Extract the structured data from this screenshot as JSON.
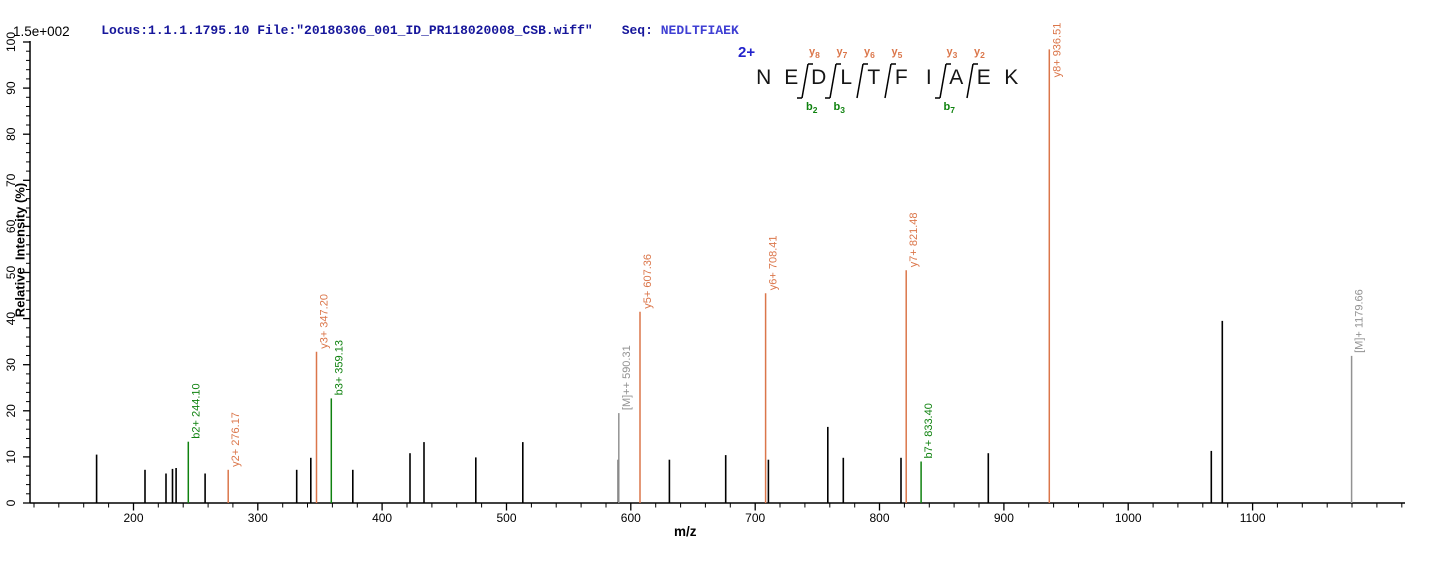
{
  "header": {
    "locus_file": "Locus:1.1.1.1795.10 File:\"20180306_001_ID_PR118020008_CSB.wiff\"",
    "seq_label": "Seq:",
    "seq_value": "NEDLTFIAEK",
    "scale_note": "1.5e+002"
  },
  "sequence": {
    "charge": "2+",
    "residues": "NEDLTFIAEK",
    "cleavages": [
      {
        "after": 2,
        "y": "y8",
        "b": "b2"
      },
      {
        "after": 3,
        "y": "y7",
        "b": "b3"
      },
      {
        "after": 4,
        "y": "y6"
      },
      {
        "after": 5,
        "y": "y5"
      },
      {
        "after": 7,
        "y": "y3",
        "b": "b7"
      },
      {
        "after": 8,
        "y": "y2"
      }
    ]
  },
  "colors": {
    "y_ion": "#DB764A",
    "b_ion": "#0F820F",
    "precursor": "#929292",
    "peak": "#000000",
    "axis": "#000000",
    "header_text": "#16169B",
    "seq_text": "#3F3FD3",
    "charge_text": "#2323CC"
  },
  "chart_data": {
    "type": "bar",
    "xlabel": "m/z",
    "ylabel": "Relative  Intensity (%)",
    "x_range": [
      116.8,
      1222.6
    ],
    "y_range": [
      0,
      100
    ],
    "x_major_ticks": [
      200,
      300,
      400,
      500,
      600,
      700,
      800,
      900,
      1000,
      1100
    ],
    "x_minor_step": 20,
    "y_major_step": 10,
    "y_minor_step": 2,
    "legend": "none",
    "grid": false,
    "annotated_peaks": [
      {
        "label": "b2+ 244.10",
        "ion": "b",
        "mz": 244.1,
        "intensity": 13.3
      },
      {
        "label": "y2+ 276.17",
        "ion": "y",
        "mz": 276.17,
        "intensity": 7.2
      },
      {
        "label": "y3+ 347.20",
        "ion": "y",
        "mz": 347.2,
        "intensity": 32.8
      },
      {
        "label": "b3+ 359.13",
        "ion": "b",
        "mz": 359.13,
        "intensity": 22.7
      },
      {
        "label": "[M]++ 590.31",
        "ion": "precursor",
        "mz": 590.31,
        "intensity": 19.5
      },
      {
        "label": "y5+ 607.36",
        "ion": "y",
        "mz": 607.36,
        "intensity": 41.5
      },
      {
        "label": "y6+ 708.41",
        "ion": "y",
        "mz": 708.41,
        "intensity": 45.5
      },
      {
        "label": "y7+ 821.48",
        "ion": "y",
        "mz": 821.48,
        "intensity": 50.5
      },
      {
        "label": "b7+ 833.40",
        "ion": "b",
        "mz": 833.4,
        "intensity": 9.0
      },
      {
        "label": "y8+ 936.51",
        "ion": "y",
        "mz": 936.51,
        "intensity": 98.4,
        "label_beside": true
      },
      {
        "label": "[M]+ 1179.66",
        "ion": "precursor",
        "mz": 1179.66,
        "intensity": 31.9
      }
    ],
    "unannotated_peaks": [
      [
        170.4,
        10.5
      ],
      [
        209.3,
        7.2
      ],
      [
        226.2,
        6.4
      ],
      [
        231.4,
        7.4
      ],
      [
        234.3,
        7.6
      ],
      [
        257.6,
        6.4
      ],
      [
        331.3,
        7.2
      ],
      [
        342.6,
        9.8
      ],
      [
        376.4,
        7.2
      ],
      [
        422.4,
        10.8
      ],
      [
        433.7,
        13.2
      ],
      [
        475.3,
        9.9
      ],
      [
        513.1,
        13.2
      ],
      [
        590.0,
        9.4
      ],
      [
        631.0,
        9.4
      ],
      [
        676.3,
        10.4
      ],
      [
        710.6,
        9.4
      ],
      [
        758.4,
        16.5
      ],
      [
        770.9,
        9.8
      ],
      [
        817.3,
        9.8
      ],
      [
        887.5,
        10.8
      ],
      [
        1066.8,
        11.3
      ],
      [
        1075.7,
        39.5
      ]
    ]
  }
}
